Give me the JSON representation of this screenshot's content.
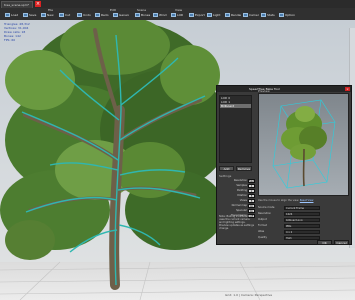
{
  "document": {
    "tab_label": "tree_scene.spm*",
    "close_glyph": "×"
  },
  "menu": [
    "File",
    "Edit",
    "Scene",
    "View"
  ],
  "toolbar": [
    {
      "label": "Load",
      "icon": "folder-icon"
    },
    {
      "label": "Save",
      "icon": "save-icon"
    },
    {
      "label": "New",
      "icon": "new-icon"
    },
    {
      "label": "Cut",
      "icon": "cut-icon"
    },
    {
      "label": "Undo",
      "icon": "undo-icon"
    },
    {
      "label": "Redo",
      "icon": "redo-icon"
    },
    {
      "label": "Generate",
      "icon": "generate-icon"
    },
    {
      "label": "Bones",
      "icon": "bones-icon"
    },
    {
      "label": "Wind",
      "icon": "wind-icon"
    },
    {
      "label": "LOD",
      "icon": "lod-icon"
    },
    {
      "label": "Export",
      "icon": "export-icon"
    },
    {
      "label": "Light",
      "icon": "light-icon"
    },
    {
      "label": "Render",
      "icon": "render-icon"
    },
    {
      "label": "Camera",
      "icon": "camera-icon"
    },
    {
      "label": "Stats",
      "icon": "stats-icon"
    },
    {
      "label": "Options",
      "icon": "options-icon"
    }
  ],
  "stats": [
    "Triangles: 48,312",
    "Vertices: 31,904",
    "Draw calls: 18",
    "Bones: 142",
    "FPS: 60"
  ],
  "status_bar": "Grid: 1.0  |  Camera: Perspective",
  "dialog": {
    "title": "SpeedTree Bake Tool",
    "close_glyph": "×",
    "list_items": [
      "LOD 0",
      "LOD 1",
      "Billboard"
    ],
    "selected_index": 2,
    "list_buttons": [
      "Add",
      "Remove"
    ],
    "preview_label": "Preview",
    "props_header": "Settings",
    "props": [
      {
        "label": "Resolution",
        "value": "512"
      },
      {
        "label": "Samples",
        "value": "4"
      },
      {
        "label": "Padding",
        "value": "2"
      },
      {
        "label": "Dilation",
        "value": "8"
      },
      {
        "label": "Views",
        "value": "8"
      },
      {
        "label": "Normal map",
        "value": "On"
      },
      {
        "label": "Specular",
        "value": "On"
      },
      {
        "label": "Transmission",
        "value": "Off"
      }
    ],
    "notes": "Note: Baking a billboard uses the current camera and lighting settings. Preview updates as settings change.",
    "hint_text": "Use the mouse to align the view.",
    "hint_link": "Reset View",
    "fields": [
      {
        "label": "Source mode",
        "value": "Current Frame"
      },
      {
        "label": "Resolution",
        "value": "1024"
      },
      {
        "label": "Output",
        "value": "billboard.png"
      },
      {
        "label": "Format",
        "value": "PNG"
      },
      {
        "label": "Atlas",
        "value": "4 x 2"
      },
      {
        "label": "Quality",
        "value": "High"
      }
    ],
    "buttons": [
      "OK",
      "Cancel"
    ]
  }
}
